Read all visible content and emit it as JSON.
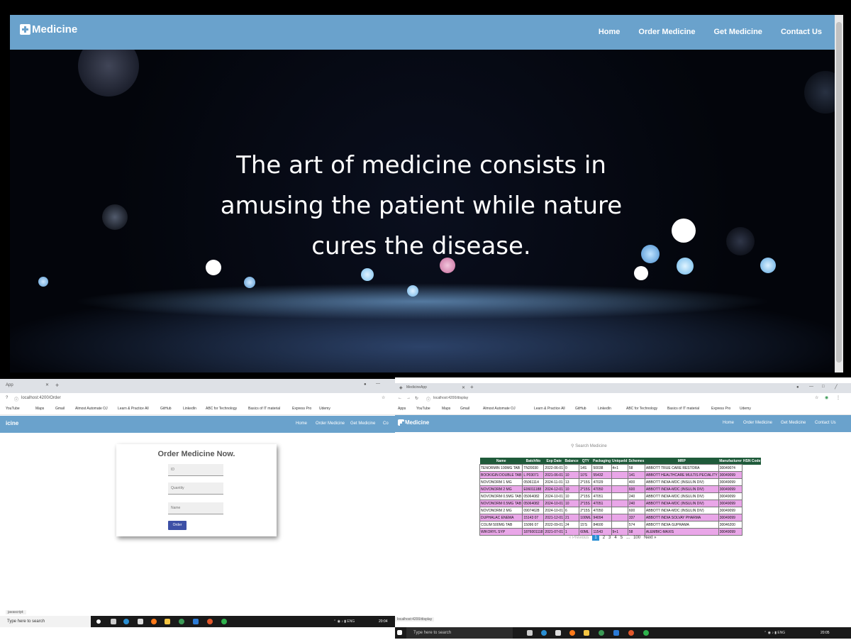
{
  "main_window": {
    "brand": "Medicine",
    "nav": [
      "Home",
      "Order Medicine",
      "Get Medicine",
      "Contact Us"
    ],
    "quote_lines": [
      "The art of medicine consists in",
      "amusing the patient while nature",
      "cures the disease."
    ]
  },
  "order_window": {
    "tab_title": "App",
    "address": "localhost:4200/Order",
    "bookmarks": [
      "YouTube",
      "Maps",
      "Gmail",
      "Almost Automate OJ",
      "Learn & Practice All",
      "GitHub",
      "LinkedIn",
      "ABC for Technology",
      "Basics of IT material",
      "Express Pro",
      "Udemy"
    ],
    "nav": [
      "Home",
      "Order Medicine",
      "Get Medicine",
      "Co"
    ],
    "card_title": "Order Medicine Now.",
    "fields": [
      "ID",
      "Quantity",
      "Name"
    ],
    "order_button": "Order",
    "status_hover": "javascript:",
    "taskbar_search": "Type here to search",
    "clock": "20:04"
  },
  "list_window": {
    "tab_title": "MedicineApp",
    "address": "localhost:4200/display",
    "bookmarks": [
      "Apps",
      "YouTube",
      "Maps",
      "Gmail",
      "Almost Automate OJ",
      "Learn & Practice All",
      "GitHub",
      "LinkedIn",
      "ABC for Technology",
      "Basics of IT material",
      "Express Pro",
      "Udemy"
    ],
    "brand": "Medicine",
    "nav": [
      "Home",
      "Order Medicine",
      "Get Medicine",
      "Contact Us"
    ],
    "search_placeholder": "Search Medicine",
    "columns": [
      "Name",
      "BatchNo",
      "Exp Date",
      "Balance",
      "QTY",
      "Packaging",
      "UniqueId",
      "Schemes",
      "MRP",
      "Manufacturer",
      "HSN Code"
    ],
    "rows": [
      {
        "c": [
          "TENORMIN 100MG TAB",
          "TN20030",
          "2022-06-01",
          "0",
          "14S",
          "50038",
          "4+1",
          "58",
          "ABBOTT TRUE CARE RESTORA",
          "30049074"
        ],
        "hl": false
      },
      {
        "c": [
          "BOOKIGIN DOUBLE TAB",
          "L P03071",
          "2021-06-01",
          "10",
          "10'S",
          "55432",
          "",
          "141",
          "ABBOTT HEALTHCARE MULTIS PECIALITY",
          "30049099"
        ],
        "hl": true
      },
      {
        "c": [
          "NOVONORM 1 MG",
          "05061114",
          "2024-11-01",
          "13",
          "2*15S",
          "47029",
          "",
          "400",
          "ABBOTT INDIA-MDC (INSULIN DIV)",
          "30049099"
        ],
        "hl": false
      },
      {
        "c": [
          "NOVONORM 2 MG",
          "E06011188",
          "2024-12-01",
          "10",
          "2*15S",
          "47050",
          "",
          "600",
          "ABBOTT INDIA-MDC (INSULIN DIV)",
          "30049099"
        ],
        "hl": true
      },
      {
        "c": [
          "NOVONORM 0.5MG TAB",
          "05064082",
          "2024-10-01",
          "10",
          "2*15S",
          "47051",
          "",
          "240",
          "ABBOTT INDIA-MDC (INSULIN DIV)",
          "30049099"
        ],
        "hl": false
      },
      {
        "c": [
          "NOVONORM 0.5MG TAB",
          "05064082",
          "2024-10-01",
          "10",
          "2*15S",
          "47051",
          "",
          "240",
          "ABBOTT INDIA-MDC (INSULIN DIV)",
          "30049099"
        ],
        "hl": true
      },
      {
        "c": [
          "NOVONORM 2 MG",
          "09074628",
          "2024-10-01",
          "6",
          "2*15S",
          "47050",
          "",
          "600",
          "ABBOTT INDIA-MDC (INSULIN DIV)",
          "30049099"
        ],
        "hl": false
      },
      {
        "c": [
          "DUPHALAC ENEMA",
          "15143 07",
          "2021-12-01",
          "21",
          "100ML",
          "94094",
          "",
          "337",
          "ABBOTT INDIA SOLVAY PHARMA",
          "30049099"
        ],
        "hl": true
      },
      {
        "c": [
          "COLIM 500MG TAB",
          "15096 07",
          "2022-09-01",
          "24",
          "15'S",
          "84600",
          "",
          "574",
          "ABBOTT INDIA-SUPRAMA",
          "30046200"
        ],
        "hl": false
      },
      {
        "c": [
          "WIKORYL SYP",
          "1876001118",
          "2021-07-01",
          "1",
          "60ML",
          "11543",
          "9+1",
          "58",
          "ALEMBIC-MAXIS",
          "30049099"
        ],
        "hl": true
      }
    ],
    "pager": {
      "prev": "Previous",
      "pages": [
        "1",
        "2",
        "3",
        "4",
        "5",
        "...",
        "100"
      ],
      "next": "Next"
    },
    "status_hover": "localhost:4200/display",
    "taskbar_search": "Type here to search",
    "clock": "20:05"
  }
}
